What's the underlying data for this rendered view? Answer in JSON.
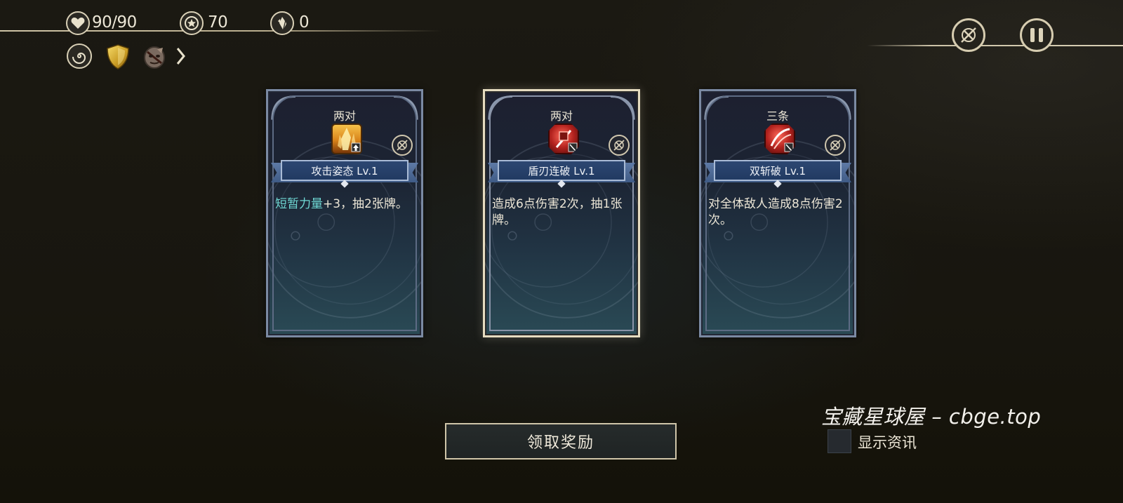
{
  "hud": {
    "hp": "90/90",
    "coins": "70",
    "shards": "0"
  },
  "relics": [
    "spiral-relic",
    "golden-shield-relic",
    "mask-relic"
  ],
  "cards": [
    {
      "rank": "两对",
      "name": "攻击姿态 Lv.1",
      "keyword": "短暂力量",
      "desc_rest": "+3，抽2张牌。",
      "icon": "flame-crystal-icon",
      "icon_color": "#d8831a",
      "selected": false
    },
    {
      "rank": "两对",
      "name": "盾刃连破 Lv.1",
      "keyword": "",
      "desc_rest": "造成6点伤害2次，抽1张牌。",
      "icon": "shield-blade-icon",
      "icon_color": "#b3221e",
      "selected": true
    },
    {
      "rank": "三条",
      "name": "双斩破 Lv.1",
      "keyword": "",
      "desc_rest": "对全体敌人造成8点伤害2次。",
      "icon": "double-slash-icon",
      "icon_color": "#b3221e",
      "selected": false
    }
  ],
  "claim_button": "领取奖励",
  "watermark": "宝藏星球屋 – cbge.top",
  "show_info_label": "显示资讯",
  "colors": {
    "keyword": "#6fd8d4",
    "hud_gold": "#d9d0b6"
  }
}
